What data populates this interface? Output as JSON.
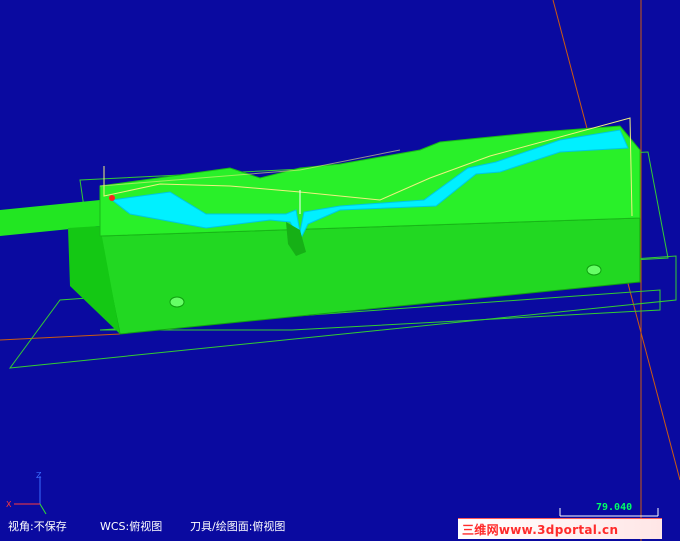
{
  "viewport": {
    "background": "#0a0aa0"
  },
  "status_bar": {
    "view": "视角:不保存",
    "wcs": "WCS:俯视图",
    "tool_plane": "刀具/绘图面:俯视图"
  },
  "scale": {
    "value": "79.040"
  },
  "axes": {
    "x": "X",
    "z": "Z"
  },
  "watermark": {
    "text": "三维网www.3dportal.cn"
  },
  "colors": {
    "model_green": "#22e622",
    "model_dark_green": "#12bb12",
    "toolpath_cyan": "#00f0ff",
    "axis_orange": "#cc5a10",
    "scale_green": "#00ff66"
  }
}
